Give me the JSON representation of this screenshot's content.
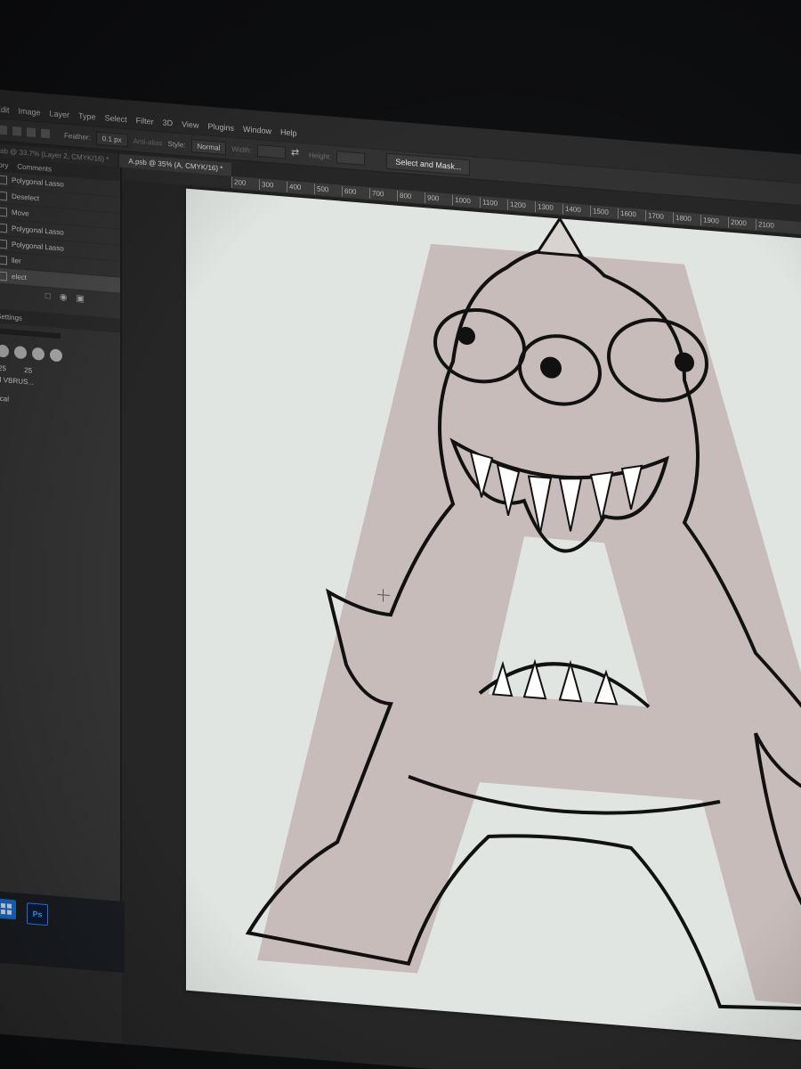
{
  "menu": {
    "items": [
      "Edit",
      "Image",
      "Layer",
      "Type",
      "Select",
      "Filter",
      "3D",
      "View",
      "Plugins",
      "Window",
      "Help"
    ]
  },
  "options": {
    "feather_label": "Feather:",
    "feather_value": "0.1 px",
    "anti_alias": "Anti-alias",
    "style_label": "Style:",
    "style_value": "Normal",
    "width_label": "Width:",
    "height_label": "Height:",
    "select_mask": "Select and Mask..."
  },
  "tabs": [
    {
      "label": "ab @ 33.7% (Layer 2, CMYK/16) *"
    },
    {
      "label": "A.psb @ 35% (A, CMYK/16) *"
    }
  ],
  "ruler": {
    "ticks": [
      "200",
      "300",
      "400",
      "500",
      "600",
      "700",
      "800",
      "900",
      "1000",
      "1100",
      "1200",
      "1300",
      "1400",
      "1500",
      "1600",
      "1700",
      "1800",
      "1900",
      "2000",
      "2100"
    ]
  },
  "history_panel": {
    "tabs": [
      "tory",
      "Comments"
    ],
    "items": [
      {
        "label": "Polygonal Lasso"
      },
      {
        "label": "Deselect"
      },
      {
        "label": "Move"
      },
      {
        "label": "Polygonal Lasso"
      },
      {
        "label": "Polygonal Lasso"
      },
      {
        "label": "ller"
      },
      {
        "label": "elect"
      }
    ]
  },
  "brush_panel": {
    "title": "Settings",
    "numbers": [
      "25",
      "25"
    ],
    "label1": "ll VBRUS...",
    "label2": "ical"
  },
  "taskbar": {
    "ps_label": "Ps"
  },
  "colors": {
    "canvas_bg": "#e1e5e2",
    "letter_fill": "#c8bcba",
    "ink": "#111111",
    "ui_dark": "#2b2b2b",
    "ps_blue": "#39a0ff"
  }
}
